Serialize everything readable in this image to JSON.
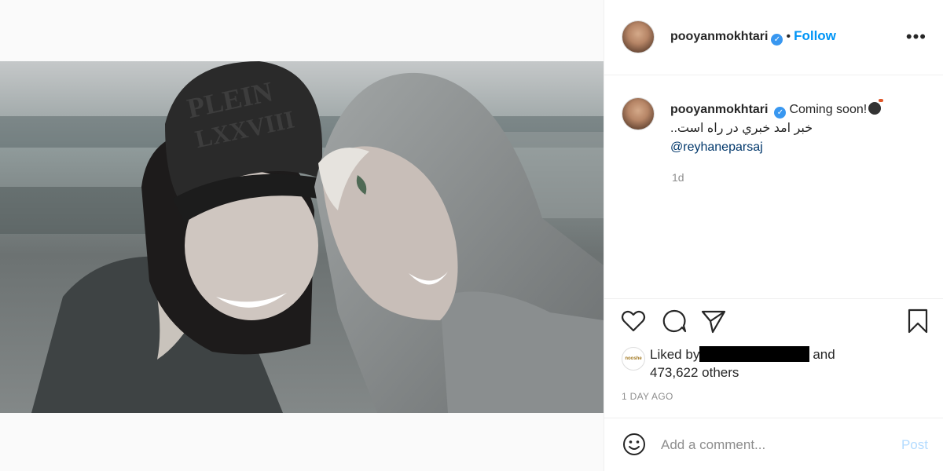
{
  "post": {
    "username": "pooyanmokhtari",
    "follow_label": "Follow",
    "separator": "•",
    "more_label": "•••",
    "verified_icon": "✓"
  },
  "photo": {
    "hat_text_line1": "PLEIN",
    "hat_text_line2": "LXXVIII"
  },
  "caption": {
    "username": "pooyanmokhtari",
    "text": "Coming soon!",
    "persian_line": "خبر امد خبري در راه است..",
    "mention": "@reyhaneparsaj",
    "time": "1d"
  },
  "likes": {
    "liker_avatar_text": "nooshe",
    "liked_by_label": "Liked by",
    "and_label": "and",
    "others": "473,622 others"
  },
  "timestamp": "1 DAY AGO",
  "comment": {
    "placeholder": "Add a comment...",
    "post_label": "Post"
  },
  "icons": {
    "like": "heart-icon",
    "comment": "comment-icon",
    "share": "paper-plane-icon",
    "save": "bookmark-icon",
    "emoji": "smiley-icon"
  },
  "colors": {
    "accent": "#0095f6",
    "mention": "#00376b",
    "verified": "#3897f0",
    "muted": "#8e8e8e",
    "post_disabled": "#b3dbff"
  }
}
